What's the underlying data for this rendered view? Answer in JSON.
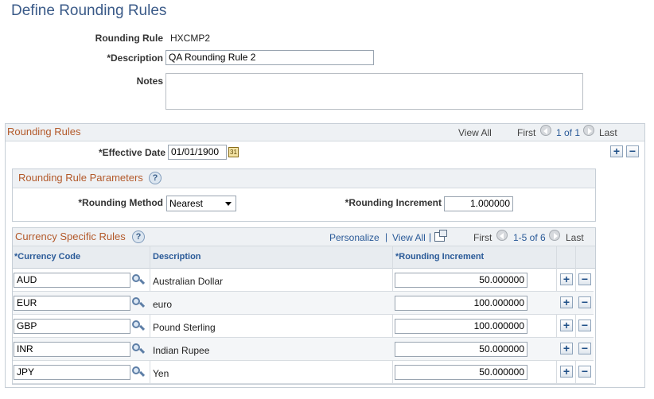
{
  "page": {
    "title": "Define Rounding Rules"
  },
  "header": {
    "rounding_rule_label": "Rounding Rule",
    "rounding_rule_value": "HXCMP2",
    "description_label": "*Description",
    "description_value": "QA Rounding Rule 2",
    "notes_label": "Notes",
    "notes_value": ""
  },
  "rounding_rules": {
    "title": "Rounding Rules",
    "view_all": "View All",
    "first": "First",
    "pager": "1 of 1",
    "last": "Last",
    "effective_date_label": "*Effective Date",
    "effective_date_value": "01/01/1900",
    "calendar_glyph": "31",
    "add_symbol": "+",
    "remove_symbol": "−"
  },
  "parameters": {
    "title": "Rounding Rule Parameters",
    "help_glyph": "?",
    "method_label": "*Rounding Method",
    "method_value": "Nearest",
    "increment_label": "*Rounding Increment",
    "increment_value": "1.000000"
  },
  "currency_rules": {
    "title": "Currency Specific Rules",
    "help_glyph": "?",
    "personalize": "Personalize",
    "separator": "|",
    "view_all": "View All",
    "first": "First",
    "pager": "1-5 of 6",
    "last": "Last",
    "columns": {
      "currency_code": "*Currency Code",
      "description": "Description",
      "rounding_increment": "*Rounding Increment"
    },
    "rows": [
      {
        "code": "AUD",
        "description": "Australian Dollar",
        "increment": "50.000000"
      },
      {
        "code": "EUR",
        "description": "euro",
        "increment": "100.000000"
      },
      {
        "code": "GBP",
        "description": "Pound Sterling",
        "increment": "100.000000"
      },
      {
        "code": "INR",
        "description": "Indian Rupee",
        "increment": "50.000000"
      },
      {
        "code": "JPY",
        "description": "Yen",
        "increment": "50.000000"
      }
    ]
  }
}
